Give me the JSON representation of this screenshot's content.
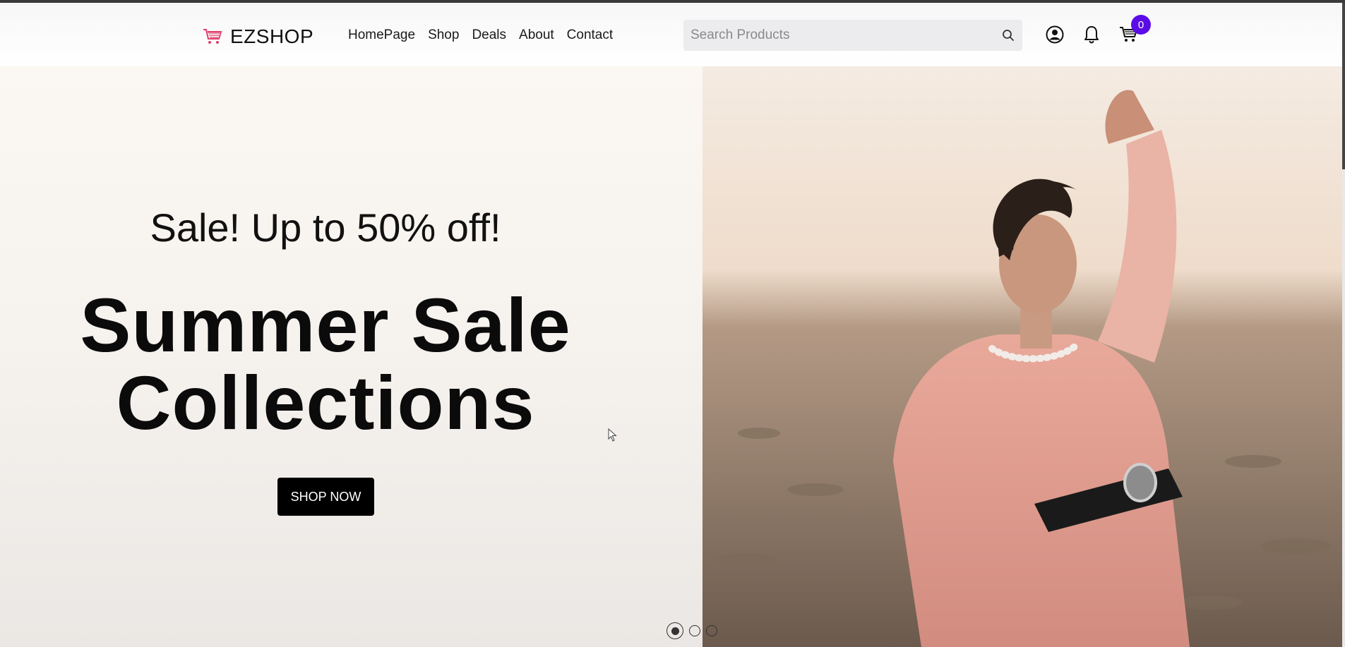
{
  "brand": {
    "name": "EZSHOP",
    "logo_icon": "shopping-cart-icon",
    "logo_color": "#e0406b"
  },
  "nav": {
    "items": [
      {
        "label": "HomePage"
      },
      {
        "label": "Shop"
      },
      {
        "label": "Deals"
      },
      {
        "label": "About"
      },
      {
        "label": "Contact"
      }
    ]
  },
  "search": {
    "placeholder": "Search Products",
    "value": ""
  },
  "header_icons": {
    "account_icon": "user-circle-icon",
    "notification_icon": "bell-icon",
    "cart_icon": "shopping-cart-icon",
    "cart_count": "0",
    "badge_color": "#5b0ce6"
  },
  "hero": {
    "subtitle": "Sale! Up to 50% off!",
    "title_line1": "Summer Sale",
    "title_line2": "Collections",
    "button_label": "SHOP NOW",
    "carousel_slides": 3,
    "active_slide": 1
  }
}
